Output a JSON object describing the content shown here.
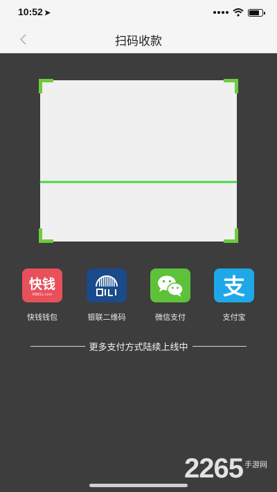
{
  "status_bar": {
    "time": "10:52",
    "location_icon": "location-arrow-icon",
    "battery_level": 0.85
  },
  "nav": {
    "title": "扫码收款",
    "back_icon": "chevron-left-icon"
  },
  "scanner": {
    "frame_color": "#6ecb3f",
    "line_color": "#3fd23a"
  },
  "payment_methods": [
    {
      "label": "快钱钱包",
      "icon": "kuaiqian-logo-icon",
      "color": "#e8505b",
      "logo_text": "快钱",
      "logo_subtext": "99BILL.com"
    },
    {
      "label": "银联二维码",
      "icon": "unionpay-qr-icon",
      "color": "#1a4a8a"
    },
    {
      "label": "微信支付",
      "icon": "wechat-icon",
      "color": "#5dc23a"
    },
    {
      "label": "支付宝",
      "icon": "alipay-icon",
      "color": "#1fa8e8",
      "logo_text": "支"
    }
  ],
  "more_methods_text": "更多支付方式陆续上线中",
  "watermark": {
    "digits": "2265",
    "site": "手游网"
  }
}
